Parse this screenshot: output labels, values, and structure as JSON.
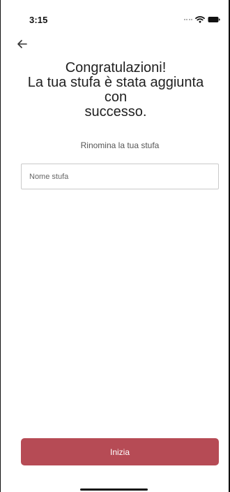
{
  "status_bar": {
    "time": "3:15"
  },
  "header": {
    "title_line_1": "Congratulazioni!",
    "title_line_2": "La tua stufa è stata aggiunta con",
    "title_line_3": "successo."
  },
  "rename_section": {
    "label": "Rinomina la tua stufa",
    "input_placeholder": "Nome stufa",
    "input_value": ""
  },
  "actions": {
    "start_label": "Inizia"
  },
  "icons": {
    "back": "back-arrow-icon",
    "wifi": "wifi-icon",
    "battery": "battery-icon",
    "signal": "signal-dots-icon"
  },
  "colors": {
    "accent": "#b64b55",
    "text": "#222222",
    "input_border": "#c9c9c9"
  }
}
